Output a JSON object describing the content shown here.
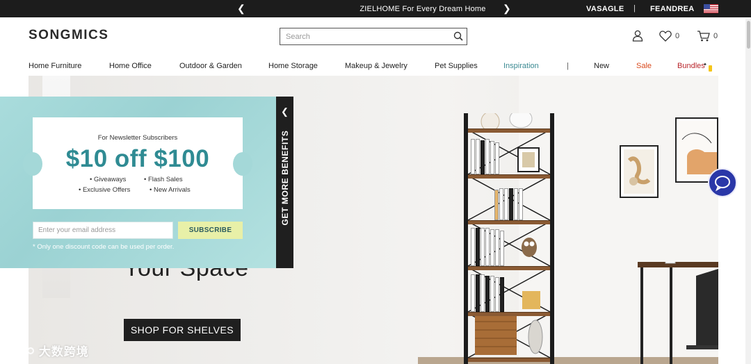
{
  "topbar": {
    "promo": "ZIELHOME For Every Dream Home",
    "brand1": "VASAGLE",
    "separator": "|",
    "brand2": "FEANDREA",
    "prev_icon": "chevron-left-icon",
    "next_icon": "chevron-right-icon",
    "flag_icon": "us-flag-icon"
  },
  "header": {
    "logo": "SONGMICS",
    "search_placeholder": "Search",
    "wishlist_count": "0",
    "cart_count": "0"
  },
  "nav": {
    "items": [
      "Home Furniture",
      "Home Office",
      "Outdoor & Garden",
      "Home Storage",
      "Makeup & Jewelry",
      "Pet Supplies",
      "Inspiration"
    ],
    "divider": "|",
    "new": "New",
    "sale": "Sale",
    "bundles": "Bundles",
    "colors": {
      "inspiration": "#3b8a92",
      "sale": "#d94a1e",
      "bundles": "#b8242a"
    }
  },
  "hero": {
    "headline_fragment": "Your Space",
    "cta": "SHOP FOR SHELVES"
  },
  "popup": {
    "subtitle": "For Newsletter Subscribers",
    "offer": "$10 off $100",
    "perks": [
      "Giveaways",
      "Flash Sales",
      "Exclusive Offers",
      "New Arrivals"
    ],
    "email_placeholder": "Enter your email address",
    "subscribe": "SUBSCRIBE",
    "note": "* Only one discount code can be used per order.",
    "side_tab": "GET MORE BENEFITS",
    "accent": "#2f8b93"
  },
  "watermark": "大数跨境"
}
